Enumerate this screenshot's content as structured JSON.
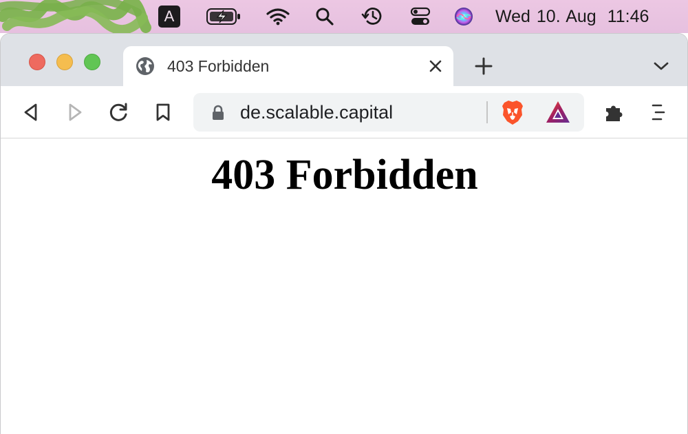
{
  "menubar": {
    "keyboard_layout": "A",
    "day": "Wed 10. Aug",
    "time": "11:46",
    "icons": [
      "keyboard-layout-icon",
      "battery-charging-icon",
      "wifi-icon",
      "spotlight-search-icon",
      "time-machine-icon",
      "control-center-icon",
      "siri-icon"
    ]
  },
  "browser": {
    "tab": {
      "title": "403 Forbidden",
      "favicon": "globe-icon"
    },
    "toolbar": {
      "url": "de.scalable.capital",
      "icons": [
        "back-icon",
        "forward-icon",
        "reload-icon",
        "bookmark-icon",
        "lock-icon",
        "brave-shields-icon",
        "brave-rewards-icon",
        "extensions-icon",
        "menu-icon"
      ]
    }
  },
  "page": {
    "heading": "403 Forbidden"
  },
  "colors": {
    "menubar_bg": "#e6c0df",
    "tabstrip_bg": "#dee1e6",
    "close_light": "#ee6a5f",
    "minimize_light": "#f5bd4f",
    "maximize_light": "#61c554",
    "brave_orange": "#fb542b"
  }
}
